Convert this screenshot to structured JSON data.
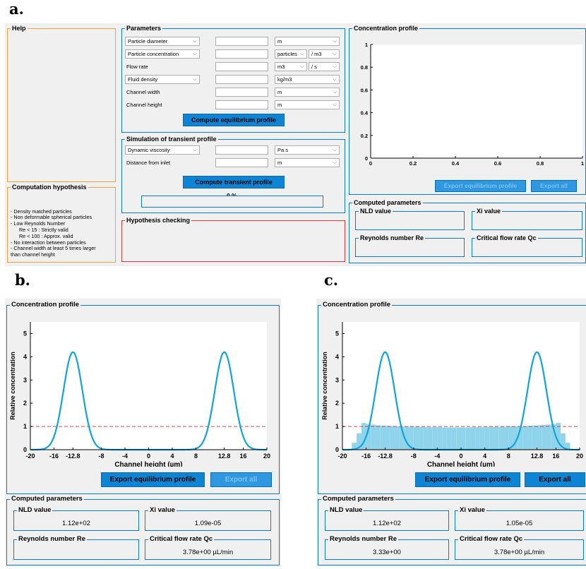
{
  "labels": {
    "a": "a.",
    "b": "b.",
    "c": "c."
  },
  "a": {
    "help_title": "Help",
    "comp_hyp_title": "Computation hypothesis",
    "comp_hyp_lines": [
      "- Density matched particles",
      "- Non deformable spherical particles",
      "- Low Reynolds Number",
      "      Re < 15 : Strictly valid",
      "      Re < 100 : Approx. valid",
      "- No interaction between particles",
      "- Channel width at least 5 times larger",
      "than channel height"
    ],
    "params_title": "Parameters",
    "params": {
      "particle_diameter": "Particle diameter",
      "particle_concentration": "Particle concentration",
      "flow_rate": "Flow rate",
      "fluid_density": "Fluid density",
      "channel_width": "Channel width",
      "channel_height": "Channel height",
      "unit_m": "m",
      "unit_particles": "particles",
      "unit_per_m3": "/ m3",
      "unit_m3": "m3",
      "unit_per_s": "/ s",
      "unit_kgm3": "kg/m3"
    },
    "compute_eq_btn": "Compute equilibrium profile",
    "sim_title": "Simulation of transient profile",
    "dyn_visc": "Dynamic viscosity",
    "distance_inlet": "Distance from inlet",
    "unit_pas": "Pa s",
    "compute_tr_btn": "Compute transient profile",
    "progress": "0 %",
    "hyp_check_title": "Hypothesis checking",
    "conc_title": "Concentration profile",
    "export_eq": "Export equilibrium profile",
    "export_all": "Export all",
    "computed_title": "Computed parameters",
    "nld": "NLD value",
    "xi": "Xi value",
    "re": "Reynolds number Re",
    "qc": "Critical flow rate Qc",
    "empty_chart": {
      "x_ticks": [
        "0",
        "0.2",
        "0.4",
        "0.6",
        "0.8",
        "1"
      ],
      "y_ticks": [
        "0",
        "0.2",
        "0.4",
        "0.6",
        "0.8",
        "1"
      ]
    }
  },
  "b": {
    "conc_title": "Concentration profile",
    "export_eq": "Export equilibrium profile",
    "export_all": "Export all",
    "computed_title": "Computed parameters",
    "nld": "NLD value",
    "nld_val": "1.12e+02",
    "xi": "Xi value",
    "xi_val": "1.09e-05",
    "re": "Reynolds number Re",
    "re_val": "",
    "qc": "Critical flow rate Qc",
    "qc_val": "3.78e+00 µL/min"
  },
  "c": {
    "conc_title": "Concentration profile",
    "export_eq": "Export equilibrium profile",
    "export_all": "Export all",
    "computed_title": "Computed parameters",
    "nld": "NLD value",
    "nld_val": "1.12e+02",
    "xi": "Xi value",
    "xi_val": "1.05e-05",
    "re": "Reynolds number Re",
    "re_val": "3.33e+00",
    "qc": "Critical flow rate Qc",
    "qc_val": "3.78e+00 µL/min"
  },
  "chart_data": [
    {
      "type": "line",
      "title": "",
      "xlabel": "Channel height (µm)",
      "ylabel": "Relative concentration",
      "xlim": [
        -20,
        20
      ],
      "ylim": [
        0,
        5.5
      ],
      "x_ticks": [
        "-20",
        "-16",
        "-12.8",
        "-8",
        "-4",
        "0",
        "4",
        "8",
        "12.8",
        "16",
        "20"
      ],
      "y_ticks": [
        "0",
        "1",
        "2",
        "3",
        "4",
        "5"
      ],
      "series": [
        {
          "type": "line",
          "peaks": [
            {
              "x": -12.8,
              "y": 4.2
            },
            {
              "x": 12.8,
              "y": 4.2
            }
          ],
          "sigma": 1.6,
          "color": "#10a4dc"
        },
        {
          "type": "reference",
          "y": 1,
          "color": "#e84040"
        }
      ]
    },
    {
      "type": "line",
      "title": "",
      "xlabel": "Channel height (µm)",
      "ylabel": "Relative concentration",
      "xlim": [
        -20,
        20
      ],
      "ylim": [
        0,
        5.5
      ],
      "x_ticks": [
        "-20",
        "-16",
        "-12.8",
        "-8",
        "-4",
        "0",
        "4",
        "8",
        "12.8",
        "16",
        "20"
      ],
      "y_ticks": [
        "0",
        "1",
        "2",
        "3",
        "4",
        "5"
      ],
      "series": [
        {
          "type": "line",
          "peaks": [
            {
              "x": -12.8,
              "y": 4.2
            },
            {
              "x": 12.8,
              "y": 4.2
            }
          ],
          "sigma": 1.6,
          "color": "#10a4dc"
        },
        {
          "type": "reference",
          "y": 1,
          "color": "#e84040"
        },
        {
          "type": "histogram",
          "color": "#8fd4ea",
          "bin_width": 0.8,
          "bins_x": [
            -18,
            -17.2,
            -16.4,
            -15.6,
            -14.8,
            -14,
            -13.2,
            -12.4,
            -11.6,
            -10.8,
            -10,
            -9.2,
            -8.4,
            -7.6,
            -6.8,
            -6,
            -5.2,
            -4.4,
            -3.6,
            -2.8,
            -2,
            -1.2,
            -0.4,
            0.4,
            1.2,
            2,
            2.8,
            3.6,
            4.4,
            5.2,
            6,
            6.8,
            7.6,
            8.4,
            9.2,
            10,
            10.8,
            11.6,
            12.4,
            13.2,
            14,
            14.8,
            15.6,
            16.4,
            17.2,
            18
          ],
          "values": [
            0.3,
            0.7,
            1.15,
            1.1,
            1.08,
            1.05,
            1.04,
            1.03,
            1.02,
            1.01,
            1.0,
            1.0,
            0.99,
            0.99,
            0.98,
            0.98,
            0.97,
            0.97,
            0.97,
            0.96,
            0.96,
            0.96,
            0.96,
            0.96,
            0.96,
            0.97,
            0.97,
            0.97,
            0.98,
            0.98,
            0.98,
            0.99,
            0.99,
            1.0,
            1.0,
            1.01,
            1.02,
            1.03,
            1.04,
            1.05,
            1.07,
            1.08,
            1.1,
            1.15,
            0.7,
            0.3
          ]
        }
      ]
    }
  ]
}
